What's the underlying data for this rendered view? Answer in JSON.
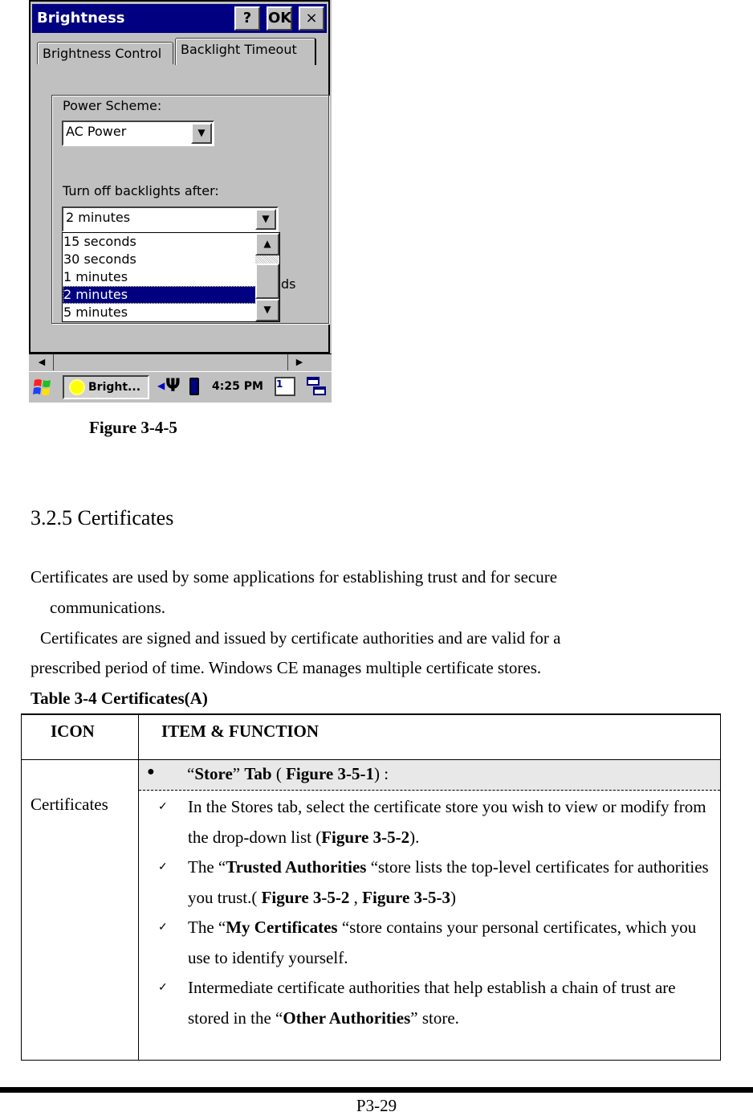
{
  "screenshot": {
    "window_title": "Brightness",
    "title_buttons": {
      "help": "?",
      "ok": "OK",
      "close": "×"
    },
    "tabs": [
      {
        "label": "Brightness Control",
        "active": false
      },
      {
        "label": "Backlight Timeout",
        "active": true
      }
    ],
    "power_scheme": {
      "label": "Power Scheme:",
      "value": "AC Power"
    },
    "turn_off": {
      "label": "Turn off backlights after:",
      "value": "2 minutes",
      "options": [
        "15 seconds",
        "30 seconds",
        "1 minutes",
        "2 minutes",
        "5 minutes"
      ],
      "selected_index": 3
    },
    "occluded_text_fragment": "ds",
    "taskbar": {
      "task_button": "Bright...",
      "clock": "4:25 PM",
      "sip_label": "1"
    },
    "colors": {
      "titlebar": "#000080",
      "face": "#c0c0c0",
      "selection": "#000080"
    }
  },
  "figure_caption": "Figure 3-4-5",
  "section_heading": "3.2.5 Certificates",
  "paragraphs": {
    "p1_line1": "Certificates are used by some applications for establishing trust and for secure",
    "p1_line2": "communications.",
    "p2_line1": "Certificates are signed and issued by certificate authorities and are valid for a",
    "p2_line2": "prescribed period of time. Windows CE manages multiple certificate stores."
  },
  "table": {
    "caption": "Table 3-4 Certificates(A)",
    "headers": {
      "icon": "ICON",
      "item": "ITEM & FUNCTION"
    },
    "row_icon": "Certificates",
    "store_tab": {
      "open_quote": "“",
      "store": "Store",
      "close_quote": "” ",
      "tab": "Tab",
      "paren_open": " ( ",
      "figure": "Figure 3-5-1",
      "paren_close": ") :"
    },
    "items": [
      {
        "pre": "In the Stores tab, select the certificate store you wish to view or modify from the drop-down list (",
        "bold": "Figure 3-5-2",
        "post": ")."
      },
      {
        "pre": "The “",
        "bold": "Trusted Authorities",
        "post": " “store lists the top-level certificates for authorities you trust.( ",
        "bold2": "Figure 3-5-2",
        "mid": " , ",
        "bold3": "Figure 3-5-3",
        "post2": ")"
      },
      {
        "pre": "The “",
        "bold": "My Certificates",
        "post": " “store contains your personal certificates, which you use to identify yourself."
      },
      {
        "pre": "Intermediate certificate authorities that help establish a chain of trust are stored in the “",
        "bold": "Other Authorities",
        "post": "” store."
      }
    ]
  },
  "footer": {
    "page_number": "P3-29"
  }
}
